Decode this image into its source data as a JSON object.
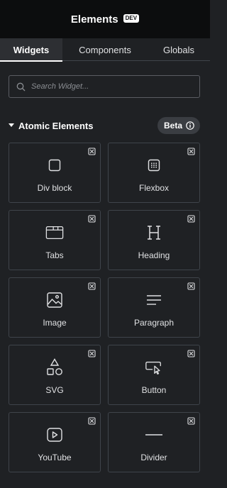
{
  "header": {
    "title": "Elements",
    "badge": "DEV"
  },
  "tabs": [
    {
      "label": "Widgets",
      "active": true
    },
    {
      "label": "Components",
      "active": false
    },
    {
      "label": "Globals",
      "active": false
    }
  ],
  "search": {
    "placeholder": "Search Widget..."
  },
  "section": {
    "title": "Atomic Elements",
    "beta_label": "Beta",
    "expanded": true
  },
  "widgets": [
    {
      "label": "Div block",
      "icon": "div-block-icon"
    },
    {
      "label": "Flexbox",
      "icon": "flexbox-icon"
    },
    {
      "label": "Tabs",
      "icon": "tabs-icon"
    },
    {
      "label": "Heading",
      "icon": "heading-icon"
    },
    {
      "label": "Image",
      "icon": "image-icon"
    },
    {
      "label": "Paragraph",
      "icon": "paragraph-icon"
    },
    {
      "label": "SVG",
      "icon": "svg-shapes-icon"
    },
    {
      "label": "Button",
      "icon": "button-cursor-icon"
    },
    {
      "label": "YouTube",
      "icon": "youtube-icon"
    },
    {
      "label": "Divider",
      "icon": "divider-icon"
    }
  ],
  "colors": {
    "panel_bg": "#1f2124",
    "header_bg": "#0c0d0e",
    "border": "#3f444b",
    "text": "#e0e1e3"
  }
}
